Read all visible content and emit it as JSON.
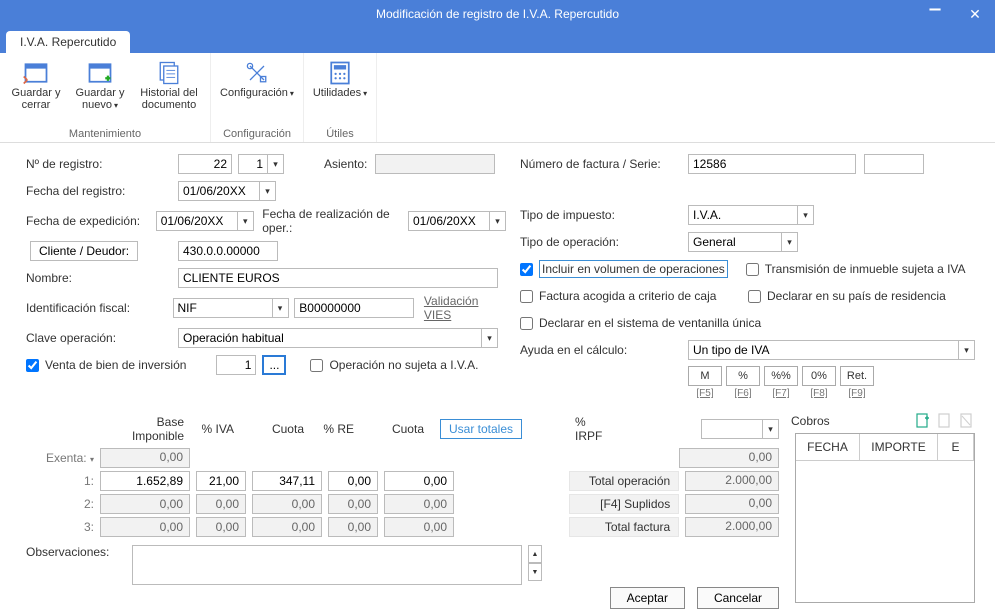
{
  "window": {
    "title": "Modificación de registro de I.V.A. Repercutido",
    "tab": "I.V.A. Repercutido"
  },
  "ribbon": {
    "group_mantenimiento": "Mantenimiento",
    "group_config": "Configuración",
    "group_utiles": "Útiles",
    "guardar_cerrar": "Guardar y cerrar",
    "guardar_nuevo": "Guardar y nuevo",
    "historial": "Historial del documento",
    "config": "Configuración",
    "utilidades": "Utilidades"
  },
  "left": {
    "nregistro_lbl": "Nº de registro:",
    "nregistro_val": "22",
    "nregistro_sub": "1",
    "asiento_lbl": "Asiento:",
    "asiento_val": "",
    "fecha_reg_lbl": "Fecha del registro:",
    "fecha_reg_val": "01/06/20XX",
    "fecha_exp_lbl": "Fecha de expedición:",
    "fecha_exp_val": "01/06/20XX",
    "fecha_real_lbl": "Fecha de realización de oper.:",
    "fecha_real_val": "01/06/20XX",
    "cliente_btn": "Cliente / Deudor:",
    "cliente_val": "430.0.0.00000",
    "nombre_lbl": "Nombre:",
    "nombre_val": "CLIENTE EUROS",
    "idfiscal_lbl": "Identificación fiscal:",
    "idfiscal_tipo": "NIF",
    "idfiscal_val": "B00000000",
    "validacion_vies": "Validación VIES",
    "clave_op_lbl": "Clave operación:",
    "clave_op_val": "Operación habitual",
    "venta_bien_chk": "Venta de bien de inversión",
    "venta_bien_num": "1",
    "venta_bien_ellipsis": "...",
    "op_no_sujeta": "Operación no sujeta a I.V.A."
  },
  "right": {
    "numfact_lbl": "Número de factura / Serie:",
    "numfact_val": "12586",
    "serie_val": "",
    "tipo_imp_lbl": "Tipo de impuesto:",
    "tipo_imp_val": "I.V.A.",
    "tipo_op_lbl": "Tipo de operación:",
    "tipo_op_val": "General",
    "chk_incluir": "Incluir en volumen de operaciones",
    "chk_transmision": "Transmisión de inmueble sujeta a IVA",
    "chk_criterio": "Factura acogida a criterio de caja",
    "chk_pais": "Declarar en su país de residencia",
    "chk_ventanilla": "Declarar en el sistema de ventanilla única",
    "ayuda_lbl": "Ayuda en el cálculo:",
    "ayuda_val": "Un tipo de IVA",
    "btn_M": "M",
    "btn_pct": "%",
    "btn_pctpct": "%%",
    "btn_0pct": "0%",
    "btn_ret": "Ret.",
    "f5": "[F5]",
    "f6": "[F6]",
    "f7": "[F7]",
    "f8": "[F8]",
    "f9": "[F9]"
  },
  "grid": {
    "h_base": "Base Imponible",
    "h_iva": "% IVA",
    "h_cuota": "Cuota",
    "h_re": "% RE",
    "h_cuota2": "Cuota",
    "usar_totales": "Usar totales",
    "h_irpf": "% IRPF",
    "exenta_lbl": "Exenta:",
    "r1_lbl": "1:",
    "r2_lbl": "2:",
    "r3_lbl": "3:",
    "exenta_base": "0,00",
    "r1": {
      "base": "1.652,89",
      "iva": "21,00",
      "cuota": "347,11",
      "re": "0,00",
      "cuota2": "0,00"
    },
    "r2": {
      "base": "0,00",
      "iva": "0,00",
      "cuota": "0,00",
      "re": "0,00",
      "cuota2": "0,00"
    },
    "r3": {
      "base": "0,00",
      "iva": "0,00",
      "cuota": "0,00",
      "re": "0,00",
      "cuota2": "0,00"
    },
    "irpf_val": "0,00",
    "tot_op_lbl": "Total operación",
    "tot_op_val": "2.000,00",
    "suplidos_lbl": "[F4] Suplidos",
    "suplidos_val": "0,00",
    "tot_fac_lbl": "Total factura",
    "tot_fac_val": "2.000,00",
    "obs_lbl": "Observaciones:",
    "obs_val": ""
  },
  "cobros": {
    "title": "Cobros",
    "h_fecha": "FECHA",
    "h_importe": "IMPORTE",
    "h_e": "E"
  },
  "footer": {
    "aceptar": "Aceptar",
    "cancelar": "Cancelar"
  }
}
